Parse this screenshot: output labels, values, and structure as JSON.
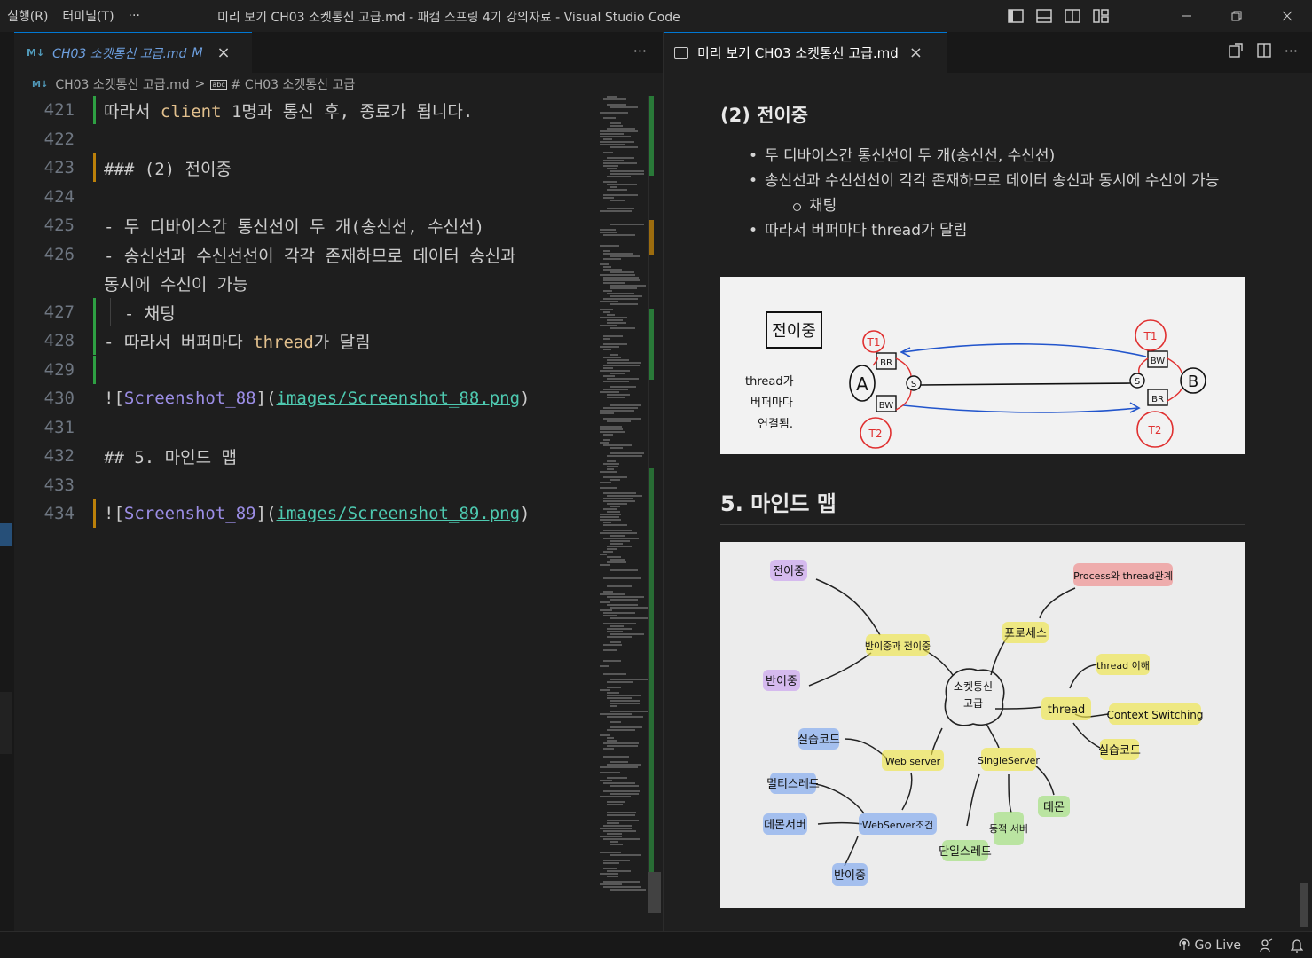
{
  "window": {
    "title": "미리 보기 CH03 소켓통신 고급.md - 패캠 스프링 4기 강의자료 - Visual Studio Code",
    "menu": [
      "실행(R)",
      "터미널(T)",
      "···"
    ]
  },
  "editor": {
    "tab": {
      "icon": "M↓",
      "label": "CH03 소켓통신 고급.md",
      "modified": "M",
      "close": "×"
    },
    "more": "···",
    "breadcrumb": {
      "file": "CH03 소켓통신 고급.md",
      "separator": ">",
      "symbol": "# CH03 소켓통신 고급"
    },
    "lines": [
      {
        "num": "421",
        "text_pre": "따라서 ",
        "kw": "client",
        "text_post": " 1명과 통신 후, 종료가 됩니다."
      },
      {
        "num": "422",
        "text": ""
      },
      {
        "num": "423",
        "text": "### (2) 전이중"
      },
      {
        "num": "424",
        "text": ""
      },
      {
        "num": "425",
        "text": "- 두 디바이스간 통신선이 두 개(송신선, 수신선)"
      },
      {
        "num": "426",
        "text": "- 송신선과 수신선선이 각각 존재하므로 데이터 송신과",
        "wrap": "동시에 수신이 가능"
      },
      {
        "num": "427",
        "text": "  - 채팅"
      },
      {
        "num": "428",
        "text_pre": "- 따라서 버퍼마다 ",
        "kw": "thread",
        "text_post": "가 달림"
      },
      {
        "num": "429",
        "text": ""
      },
      {
        "num": "430",
        "alt": "Screenshot_88",
        "url": "images/Screenshot_88.png"
      },
      {
        "num": "431",
        "text": ""
      },
      {
        "num": "432",
        "text": "## 5. 마인드 맵"
      },
      {
        "num": "433",
        "text": ""
      },
      {
        "num": "434",
        "alt": "Screenshot_89",
        "url": "images/Screenshot_89.png"
      }
    ]
  },
  "preview": {
    "tab": {
      "label": "미리 보기 CH03 소켓통신 고급.md",
      "close": "×"
    },
    "heading3": "(2) 전이중",
    "bullets": [
      {
        "level": 1,
        "text": "두 디바이스간 통신선이 두 개(송신선, 수신선)"
      },
      {
        "level": 1,
        "text": "송신선과 수신선선이 각각 존재하므로 데이터 송신과 동시에 수신이 가능"
      },
      {
        "level": 2,
        "text": "채팅"
      },
      {
        "level": 1,
        "text": "따라서 버퍼마다 thread가 달림"
      }
    ],
    "heading2": "5. 마인드 맵",
    "diagram1": {
      "title": "전이중",
      "note": [
        "thread가",
        "버퍼마다",
        "연결됨."
      ],
      "labels": [
        "A",
        "B",
        "S",
        "S",
        "BR",
        "BW",
        "BW",
        "BR",
        "T1",
        "T2",
        "T1",
        "T2"
      ]
    },
    "mindmap": {
      "center": [
        "소켓통신",
        "고급"
      ],
      "nodes": [
        "전이중",
        "반이중",
        "반이중과 전이중",
        "프로세스",
        "Process와 thread관계",
        "thread",
        "thread 이해",
        "Context Switching",
        "실습코드",
        "실습코드",
        "Web server",
        "멀티스레드",
        "데몬서버",
        "WebServer조건",
        "반이중",
        "SingleServer",
        "단일스레드",
        "동적 서버",
        "데몬"
      ]
    }
  },
  "statusbar": {
    "golive": "Go Live"
  }
}
